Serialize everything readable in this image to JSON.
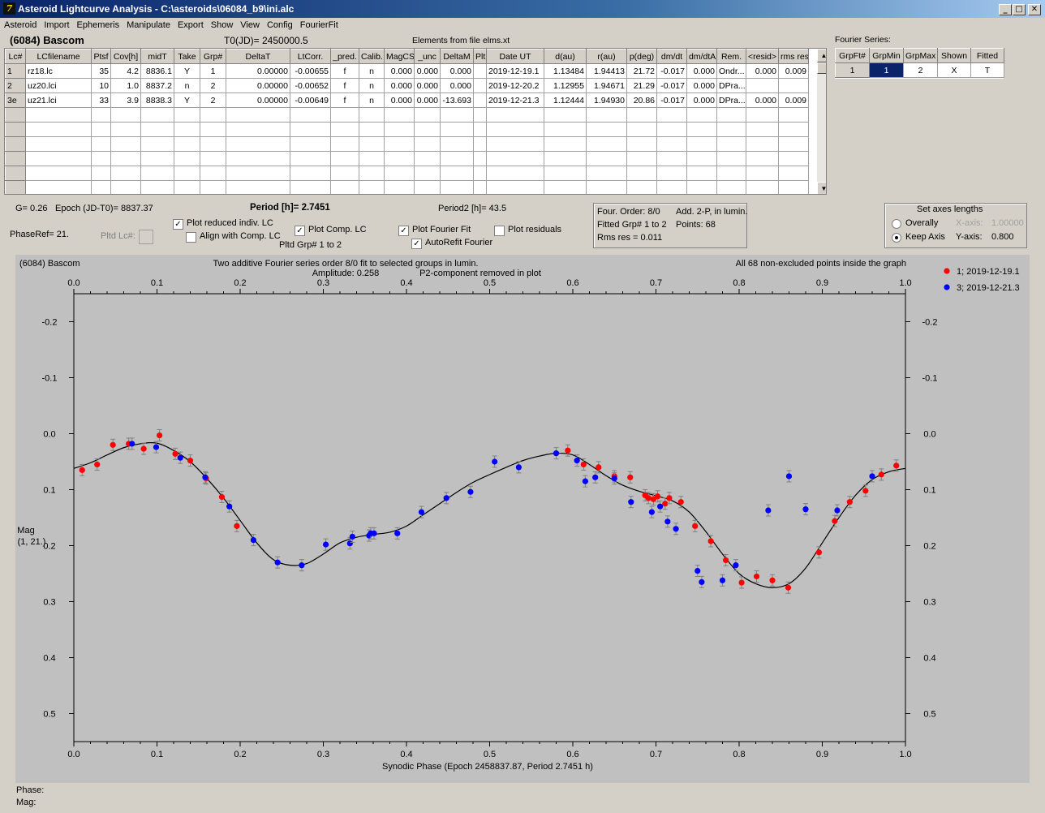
{
  "window": {
    "title": "Asteroid Lightcurve Analysis - C:\\asteroids\\06084_b9\\ini.alc",
    "app_icon": "7",
    "min_glyph": "_",
    "max_glyph": "□",
    "close_glyph": "✕"
  },
  "menu": [
    "Asteroid",
    "Import",
    "Ephemeris",
    "Manipulate",
    "Export",
    "Show",
    "View",
    "Config",
    "FourierFit"
  ],
  "header": {
    "object": "(6084) Bascom",
    "t0": "T0(JD)= 2450000.5",
    "elements": "Elements from file elms.xt"
  },
  "table": {
    "columns": [
      "Lc#",
      "LCfilename",
      "Ptsf",
      "Cov[h]",
      "midT",
      "Take",
      "Grp#",
      "DeltaT",
      "LtCorr.",
      "_pred.",
      "Calib.",
      "MagCS",
      "_unc",
      "DeltaM",
      "Plt",
      "Date UT",
      "d(au)",
      "r(au)",
      "p(deg)",
      "dm/dt",
      "dm/dtA",
      "Rem.",
      "<resid>",
      "rms res"
    ],
    "rows": [
      [
        "1",
        "rz18.lc",
        "35",
        "4.2",
        "8836.1",
        "Y",
        "1",
        "0.00000",
        "-0.00655",
        "f",
        "n",
        "0.000",
        "0.000",
        "0.000",
        "",
        "2019-12-19.1",
        "1.13484",
        "1.94413",
        "21.72",
        "-0.017",
        "0.000",
        "Ondr...",
        "0.000",
        "0.009"
      ],
      [
        "2",
        "uz20.lci",
        "10",
        "1.0",
        "8837.2",
        "n",
        "2",
        "0.00000",
        "-0.00652",
        "f",
        "n",
        "0.000",
        "0.000",
        "0.000",
        "",
        "2019-12-20.2",
        "1.12955",
        "1.94671",
        "21.29",
        "-0.017",
        "0.000",
        "DPra...",
        "",
        ""
      ],
      [
        "3e",
        "uz21.lci",
        "33",
        "3.9",
        "8838.3",
        "Y",
        "2",
        "0.00000",
        "-0.00649",
        "f",
        "n",
        "0.000",
        "0.000",
        "-13.693",
        "",
        "2019-12-21.3",
        "1.12444",
        "1.94930",
        "20.86",
        "-0.017",
        "0.000",
        "DPra...",
        "0.000",
        "0.009"
      ]
    ],
    "empty_rows": 6,
    "scroll_up": "▲",
    "scroll_down": "▼"
  },
  "fourier_series": {
    "title": "Fourier Series:",
    "columns": [
      "GrpFt#",
      "GrpMin",
      "GrpMax",
      "Shown",
      "Fitted"
    ],
    "row": [
      "1",
      "1",
      "2",
      "X",
      "T"
    ]
  },
  "params": {
    "g": "G= 0.26",
    "epoch": "Epoch (JD-T0)= 8837.37",
    "period": "Period [h]= 2.7451",
    "period2": "Period2 [h]= 43.5",
    "phaseref": "PhaseRef= 21.",
    "pltd_lc": "Pltd Lc#:",
    "pltd_grp": "Pltd Grp#  1   to   2"
  },
  "checkboxes": {
    "plot_reduced": {
      "label": "Plot reduced indiv. LC",
      "checked": true
    },
    "align_comp": {
      "label": "Align with Comp. LC",
      "checked": false
    },
    "plot_comp": {
      "label": "Plot Comp. LC",
      "checked": true
    },
    "plot_fourier": {
      "label": "Plot Fourier Fit",
      "checked": true
    },
    "plot_residuals": {
      "label": "Plot residuals",
      "checked": false
    },
    "autorefit": {
      "label": "AutoRefit Fourier",
      "checked": true
    },
    "check_glyph": "✓"
  },
  "fit_info": {
    "order": "Four. Order:  8/0",
    "add": "Add. 2-P, in lumin.",
    "fitted": "Fitted Grp# 1 to 2",
    "points": "Points: 68",
    "rms": "Rms res      = 0.011"
  },
  "axes_lengths": {
    "title": "Set axes lengths",
    "overally": "Overally",
    "keep_axis": "Keep Axis",
    "xaxis_label": "X-axis:",
    "xaxis_value": "1.00000",
    "yaxis_label": "Y-axis:",
    "yaxis_value": "0.800",
    "selected": "keep_axis"
  },
  "plot": {
    "object": "(6084) Bascom",
    "subtitle1": "Two additive Fourier series order 8/0 fit to selected groups in lumin.",
    "subtitle2": "Amplitude: 0.258",
    "subtitle3": "P2-component removed in plot",
    "note": "All 68 non-excluded points inside the graph",
    "ylabel1": "Mag",
    "ylabel2": "(1, 21.)",
    "xlabel": "Synodic Phase (Epoch 2458837.87, Period 2.7451 h)",
    "phase_label": "Phase:",
    "mag_label": "Mag:"
  },
  "chart_data": {
    "type": "scatter",
    "title": "Two additive Fourier series order 8/0 fit to selected groups in lumin.",
    "xlabel": "Synodic Phase (Epoch 2458837.87, Period 2.7451 h)",
    "ylabel": "Mag (1, 21.)",
    "xlim": [
      0,
      1
    ],
    "ylim": [
      0.55,
      -0.25
    ],
    "x_ticks": [
      "0.0",
      "0.1",
      "0.2",
      "0.3",
      "0.4",
      "0.5",
      "0.6",
      "0.7",
      "0.8",
      "0.9",
      "1.0"
    ],
    "y_ticks": [
      -0.2,
      -0.1,
      0.0,
      0.1,
      0.2,
      0.3,
      0.4,
      0.5
    ],
    "y_tick_labels": [
      "-0.2",
      "-0.1",
      "0.0",
      "0.1",
      "0.2",
      "0.3",
      "0.4",
      "0.5"
    ],
    "legend_position": "top-right",
    "grid": false,
    "series": [
      {
        "name": "1; 2019-12-19.1",
        "color": "#ff0000",
        "x": [
          0.01,
          0.028,
          0.047,
          0.066,
          0.084,
          0.103,
          0.122,
          0.14,
          0.159,
          0.178,
          0.196,
          0.594,
          0.613,
          0.631,
          0.65,
          0.669,
          0.687,
          0.691,
          0.697,
          0.702,
          0.711,
          0.716,
          0.73,
          0.747,
          0.766,
          0.784,
          0.803,
          0.821,
          0.84,
          0.859,
          0.896,
          0.915,
          0.933,
          0.952,
          0.971,
          0.989
        ],
        "y": [
          0.065,
          0.055,
          0.02,
          0.018,
          0.027,
          0.003,
          0.036,
          0.048,
          0.08,
          0.113,
          0.165,
          0.03,
          0.055,
          0.06,
          0.076,
          0.078,
          0.11,
          0.115,
          0.117,
          0.112,
          0.125,
          0.115,
          0.122,
          0.165,
          0.192,
          0.226,
          0.266,
          0.255,
          0.262,
          0.275,
          0.212,
          0.156,
          0.122,
          0.102,
          0.073,
          0.057
        ]
      },
      {
        "name": "3; 2019-12-21.3",
        "color": "#0000ff",
        "x": [
          0.07,
          0.099,
          0.128,
          0.158,
          0.187,
          0.216,
          0.245,
          0.274,
          0.303,
          0.332,
          0.335,
          0.355,
          0.357,
          0.361,
          0.389,
          0.418,
          0.448,
          0.477,
          0.506,
          0.535,
          0.58,
          0.605,
          0.615,
          0.627,
          0.65,
          0.67,
          0.695,
          0.705,
          0.714,
          0.724,
          0.75,
          0.755,
          0.78,
          0.796,
          0.835,
          0.86,
          0.88,
          0.918,
          0.96
        ],
        "y": [
          0.018,
          0.024,
          0.043,
          0.078,
          0.13,
          0.19,
          0.23,
          0.235,
          0.198,
          0.196,
          0.184,
          0.182,
          0.178,
          0.178,
          0.178,
          0.14,
          0.115,
          0.104,
          0.05,
          0.06,
          0.035,
          0.048,
          0.085,
          0.078,
          0.08,
          0.122,
          0.14,
          0.13,
          0.157,
          0.17,
          0.245,
          0.265,
          0.262,
          0.235,
          0.137,
          0.076,
          0.135,
          0.137,
          0.076
        ]
      }
    ],
    "fit_curve": {
      "name": "Fourier fit",
      "color": "#000000",
      "x": [
        0.0,
        0.02,
        0.04,
        0.06,
        0.08,
        0.1,
        0.12,
        0.14,
        0.16,
        0.18,
        0.2,
        0.22,
        0.24,
        0.26,
        0.28,
        0.3,
        0.32,
        0.34,
        0.36,
        0.38,
        0.4,
        0.42,
        0.44,
        0.46,
        0.48,
        0.5,
        0.52,
        0.54,
        0.56,
        0.58,
        0.6,
        0.62,
        0.64,
        0.66,
        0.68,
        0.7,
        0.72,
        0.74,
        0.76,
        0.78,
        0.8,
        0.82,
        0.84,
        0.86,
        0.88,
        0.9,
        0.92,
        0.94,
        0.96,
        0.98,
        1.0
      ],
      "y": [
        0.062,
        0.052,
        0.038,
        0.025,
        0.018,
        0.017,
        0.03,
        0.05,
        0.08,
        0.115,
        0.155,
        0.195,
        0.225,
        0.235,
        0.232,
        0.215,
        0.195,
        0.185,
        0.18,
        0.176,
        0.165,
        0.145,
        0.125,
        0.105,
        0.087,
        0.073,
        0.06,
        0.048,
        0.04,
        0.035,
        0.038,
        0.055,
        0.075,
        0.092,
        0.103,
        0.111,
        0.12,
        0.14,
        0.175,
        0.215,
        0.25,
        0.268,
        0.275,
        0.268,
        0.24,
        0.195,
        0.15,
        0.11,
        0.082,
        0.068,
        0.062
      ]
    }
  }
}
